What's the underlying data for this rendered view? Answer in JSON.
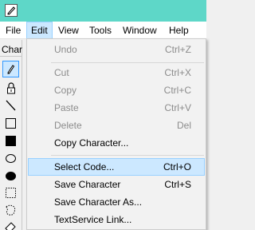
{
  "window": {
    "app_icon": "pen-icon"
  },
  "menubar": {
    "items": [
      {
        "label": "File"
      },
      {
        "label": "Edit"
      },
      {
        "label": "View"
      },
      {
        "label": "Tools"
      },
      {
        "label": "Window"
      },
      {
        "label": "Help"
      }
    ]
  },
  "sidebar": {
    "label": "Chara",
    "tools": [
      {
        "icon": "pencil-icon"
      },
      {
        "icon": "lock-icon"
      },
      {
        "icon": "line-icon"
      },
      {
        "icon": "rectangle-outline-icon"
      },
      {
        "icon": "rectangle-filled-icon"
      },
      {
        "icon": "ellipse-outline-icon"
      },
      {
        "icon": "ellipse-filled-icon"
      },
      {
        "icon": "rect-select-icon"
      },
      {
        "icon": "freeform-select-icon"
      },
      {
        "icon": "eraser-icon"
      }
    ]
  },
  "edit_menu": {
    "items": [
      {
        "label": "Undo",
        "shortcut": "Ctrl+Z"
      },
      {
        "label": "Cut",
        "shortcut": "Ctrl+X"
      },
      {
        "label": "Copy",
        "shortcut": "Ctrl+C"
      },
      {
        "label": "Paste",
        "shortcut": "Ctrl+V"
      },
      {
        "label": "Delete",
        "shortcut": "Del"
      },
      {
        "label": "Copy Character...",
        "shortcut": ""
      },
      {
        "label": "Select Code...",
        "shortcut": "Ctrl+O"
      },
      {
        "label": "Save Character",
        "shortcut": "Ctrl+S"
      },
      {
        "label": "Save Character As...",
        "shortcut": ""
      },
      {
        "label": "TextService Link...",
        "shortcut": ""
      }
    ]
  }
}
